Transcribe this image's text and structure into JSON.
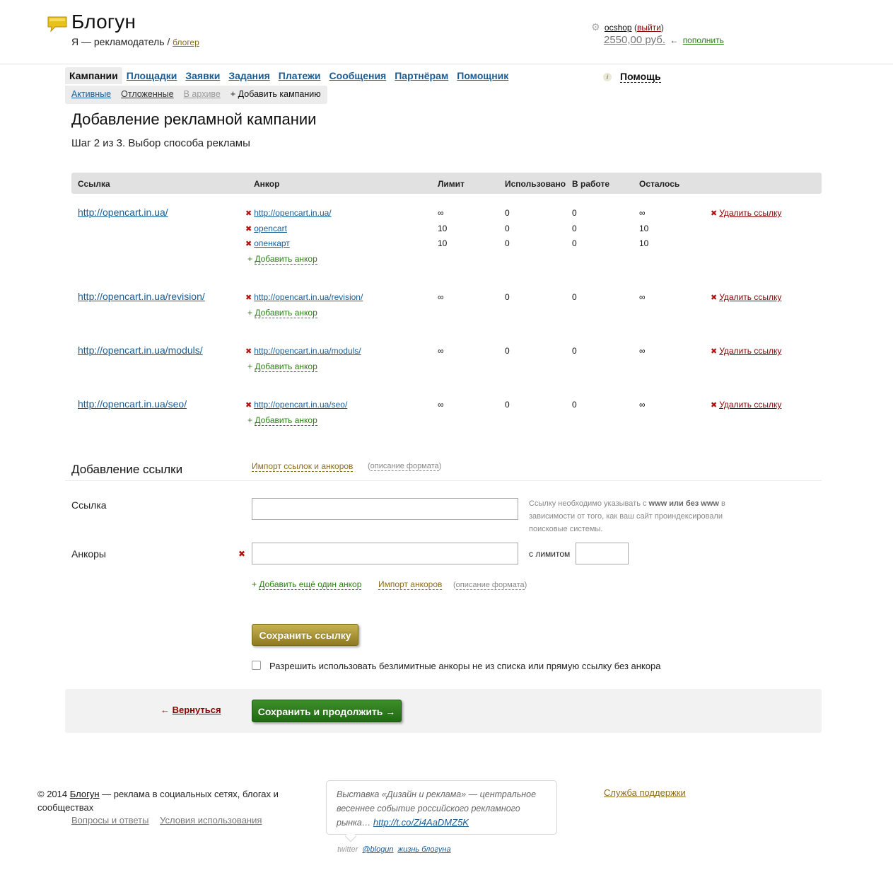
{
  "header": {
    "logo_text": "Блогун",
    "role_current": "Я — рекламодатель",
    "role_separator": "/",
    "role_switch": "блогер",
    "username": "ocshop",
    "logout": "выйти",
    "balance": "2550,00 руб.",
    "balance_arrow": "←",
    "topup": "пополнить",
    "help": "Помощь"
  },
  "nav": {
    "tabs": [
      "Кампании",
      "Площадки",
      "Заявки",
      "Задания",
      "Платежи",
      "Сообщения",
      "Партнёрам",
      "Помощник"
    ],
    "subtabs": [
      "Активные",
      "Отложенные",
      "В архиве",
      "+ Добавить кампанию"
    ]
  },
  "page": {
    "title": "Добавление рекламной кампании",
    "step": "Шаг 2 из 3. Выбор способа рекламы"
  },
  "table": {
    "headers": [
      "Ссылка",
      "Анкор",
      "Лимит",
      "Использовано",
      "В работе",
      "Осталось"
    ],
    "delete_label": "Удалить ссылку",
    "add_anchor_label": "Добавить анкор",
    "rows": [
      {
        "url": "http://opencart.in.ua/",
        "anchors": [
          {
            "text": "http://opencart.in.ua/",
            "limit": "∞",
            "used": "0",
            "in_work": "0",
            "left": "∞"
          },
          {
            "text": "opencart",
            "limit": "10",
            "used": "0",
            "in_work": "0",
            "left": "10"
          },
          {
            "text": "опенкарт",
            "limit": "10",
            "used": "0",
            "in_work": "0",
            "left": "10"
          }
        ]
      },
      {
        "url": "http://opencart.in.ua/revision/",
        "anchors": [
          {
            "text": "http://opencart.in.ua/revision/",
            "limit": "∞",
            "used": "0",
            "in_work": "0",
            "left": "∞"
          }
        ]
      },
      {
        "url": "http://opencart.in.ua/moduls/",
        "anchors": [
          {
            "text": "http://opencart.in.ua/moduls/",
            "limit": "∞",
            "used": "0",
            "in_work": "0",
            "left": "∞"
          }
        ]
      },
      {
        "url": "http://opencart.in.ua/seo/",
        "anchors": [
          {
            "text": "http://opencart.in.ua/seo/",
            "limit": "∞",
            "used": "0",
            "in_work": "0",
            "left": "∞"
          }
        ]
      }
    ]
  },
  "add_link": {
    "title": "Добавление ссылки",
    "import_label": "Импорт ссылок и анкоров",
    "format_label": "описание формата",
    "link_label": "Ссылка",
    "link_value": "",
    "hint_pre": "Ссылку необходимо указывать с ",
    "hint_bold": "www или без www",
    "hint_post": " в зависимости от того, как ваш сайт проиндексировали поисковые системы.",
    "anchors_label": "Анкоры",
    "anchor_value": "",
    "limit_label": "с лимитом",
    "limit_value": "",
    "more_anchor": "Добавить ещё один анкор",
    "import_anchors": "Импорт анкоров",
    "save_link": "Сохранить ссылку",
    "checkbox_label": "Разрешить использовать безлимитные анкоры не из списка или прямую ссылку без анкора",
    "checkbox_checked": false
  },
  "actions": {
    "back_arrow": "←",
    "back": "Вернуться",
    "save_continue": "Сохранить и продолжить →"
  },
  "footer": {
    "copyright_prefix": "© 2014",
    "brand": "Блогун",
    "tagline": "— реклама в социальных сетях, блогах и сообществах",
    "links": [
      "Вопросы и ответы",
      "Условия использования"
    ],
    "tweet_text": "Выставка «Дизайн и реклама» — центральное весеннее событие российского рекламного рынка…",
    "tweet_link": "http://t.co/Zi4AaDMZ5K",
    "twitter_label": "twitter",
    "twitter_handle": "@blogun",
    "blog_label": "жизнь блогуна",
    "support": "Служба поддержки"
  },
  "colors": {
    "link_blue": "#1a5d95",
    "delete_red": "#8b0000",
    "add_green": "#2d7d17",
    "gold": "#8a6d1c",
    "button_green": "#2a7a1a",
    "button_gold": "#a8922f"
  },
  "icons": [
    "logo-speech-bubble-icon",
    "gear-icon",
    "info-icon",
    "delete-x-icon",
    "checkbox"
  ]
}
